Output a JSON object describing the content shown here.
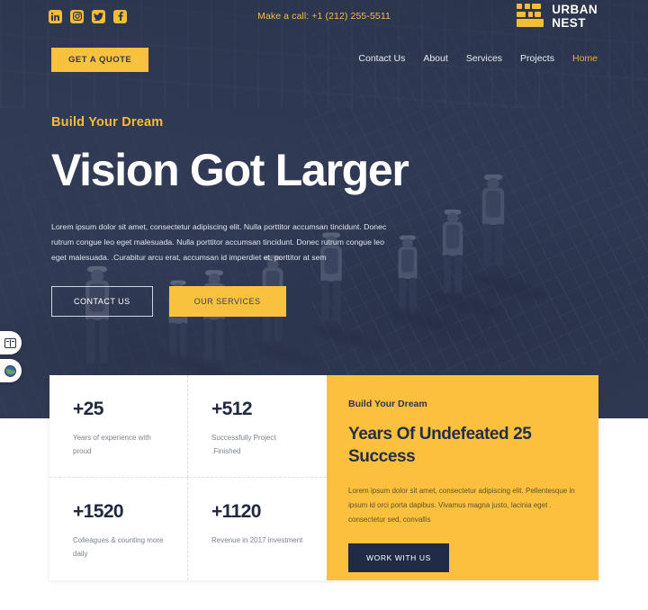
{
  "topbar": {
    "socials": [
      {
        "name": "linkedin-icon",
        "label": "in"
      },
      {
        "name": "instagram-icon",
        "label": "IG"
      },
      {
        "name": "twitter-icon",
        "label": "tw"
      },
      {
        "name": "facebook-icon",
        "label": "f"
      }
    ],
    "call_text": "Make a call: +1 (212) 255-5511",
    "brand_line1": "URBAN",
    "brand_line2": "NEST",
    "brand_mark_icon": "brick-blocks-icon"
  },
  "nav": {
    "quote_button": "GET A QUOTE",
    "links": [
      {
        "label": "Contact Us",
        "active": false
      },
      {
        "label": "About",
        "active": false
      },
      {
        "label": "Services",
        "active": false
      },
      {
        "label": "Projects",
        "active": false
      },
      {
        "label": "Home",
        "active": true
      }
    ]
  },
  "hero": {
    "eyebrow": "Build Your Dream",
    "title": "Vision Got Larger",
    "paragraph": "Lorem ipsum dolor sit amet, consectetur adipiscing elit. Nulla porttitor accumsan tincidunt. Donec rutrum congue leo eget malesuada. Nulla porttitor accumsan tincidunt. Donec rutrum congue leo eget malesuada. .Curabitur arcu erat, accumsan id imperdiet et, porttitor at sem",
    "btn_outline": "CONTACT US",
    "btn_solid": "OUR SERVICES"
  },
  "float_widgets": [
    {
      "name": "accessibility-reader-icon",
      "glyph": "book"
    },
    {
      "name": "accessibility-globe-icon",
      "glyph": "globe"
    }
  ],
  "stats": [
    {
      "number": "+25",
      "label": "Years of experience with proud"
    },
    {
      "number": "+512",
      "label": "Successfully Project .Finished"
    },
    {
      "number": "+1520",
      "label": "Colleagues & counting more daily"
    },
    {
      "number": "+1120",
      "label": "Revenue in 2017 investment"
    }
  ],
  "promo": {
    "eyebrow": "Build Your Dream",
    "title": "Years Of Undefeated 25 Success",
    "paragraph": "Lorem ipsum dolor sit amet, consectetur adipiscing elit. Pellentesque in ipsum id orci porta dapibus. Vivamus magna justo, lacinia eget . consectetur sed, convallis",
    "button": "WORK WITH US"
  },
  "colors": {
    "accent_yellow": "#fbc13e",
    "dark_navy": "#2b3450",
    "hero_bg": "#323d56",
    "nav_active": "#f0a93a"
  }
}
